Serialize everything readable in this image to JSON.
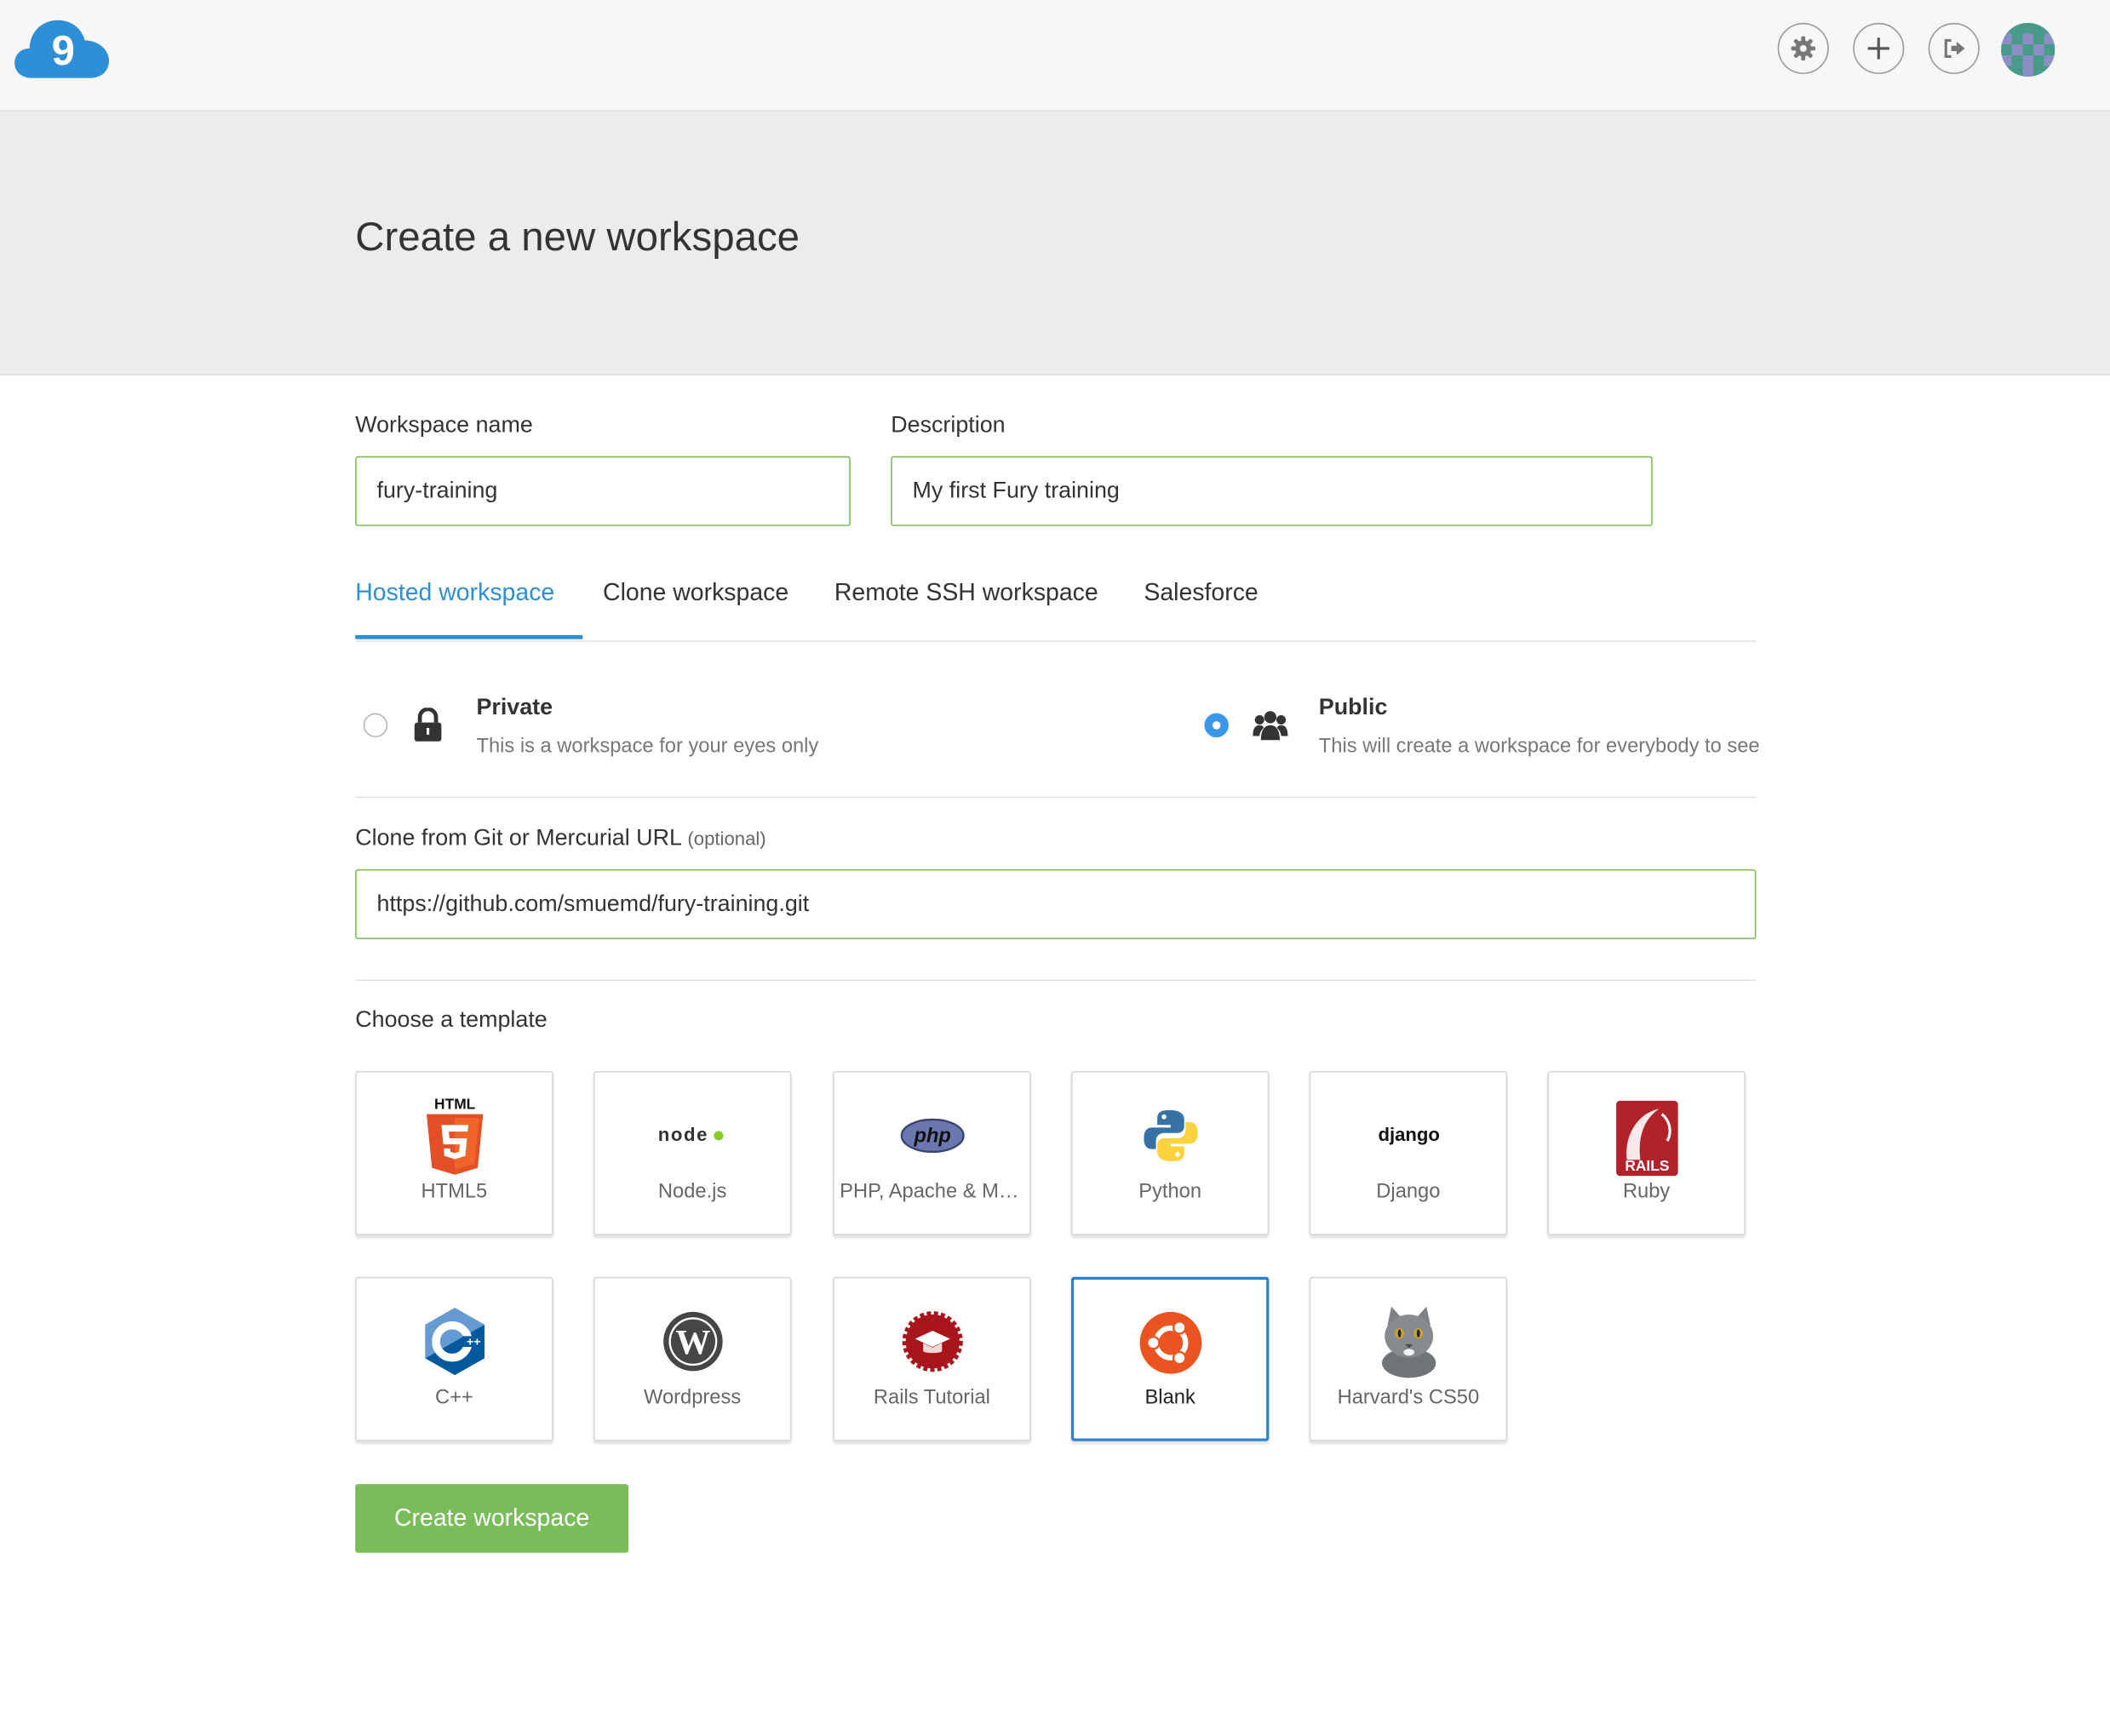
{
  "header": {
    "logo_icon": "cloud9-logo-icon",
    "logo_text": "9",
    "buttons": [
      {
        "icon": "gear-icon",
        "label": "Settings"
      },
      {
        "icon": "plus-icon",
        "label": "New"
      },
      {
        "icon": "sign-out-icon",
        "label": "Sign out"
      }
    ],
    "avatar_icon": "user-avatar"
  },
  "page": {
    "title": "Create a new workspace"
  },
  "form": {
    "workspace_name": {
      "label": "Workspace name",
      "value": "fury-training"
    },
    "description": {
      "label": "Description",
      "value": "My first Fury training"
    },
    "tabs": [
      {
        "label": "Hosted workspace",
        "active": true
      },
      {
        "label": "Clone workspace",
        "active": false
      },
      {
        "label": "Remote SSH workspace",
        "active": false
      },
      {
        "label": "Salesforce",
        "active": false
      }
    ],
    "visibility": {
      "private": {
        "title": "Private",
        "desc": "This is a workspace for your eyes only",
        "icon": "lock-icon",
        "selected": false
      },
      "public": {
        "title": "Public",
        "desc": "This will create a workspace for everybody to see",
        "icon": "users-icon",
        "selected": true
      }
    },
    "clone_url": {
      "label": "Clone from Git or Mercurial URL",
      "optional": "(optional)",
      "value": "https://github.com/smuemd/fury-training.git"
    },
    "template_heading": "Choose a template",
    "templates": [
      {
        "name": "HTML5",
        "icon": "html5-icon",
        "logo_text": "HTML"
      },
      {
        "name": "Node.js",
        "icon": "nodejs-icon",
        "logo_text": "node"
      },
      {
        "name": "PHP, Apache & MySQL",
        "icon": "php-icon",
        "logo_text": "php"
      },
      {
        "name": "Python",
        "icon": "python-icon"
      },
      {
        "name": "Django",
        "icon": "django-icon",
        "logo_text": "django"
      },
      {
        "name": "Ruby",
        "icon": "rails-icon",
        "logo_text": "RAILS"
      },
      {
        "name": "C++",
        "icon": "cpp-icon",
        "logo_text": "C++"
      },
      {
        "name": "Wordpress",
        "icon": "wordpress-icon",
        "logo_text": "W"
      },
      {
        "name": "Rails Tutorial",
        "icon": "rails-tutorial-icon"
      },
      {
        "name": "Blank",
        "icon": "ubuntu-icon",
        "selected": true
      },
      {
        "name": "Harvard's CS50",
        "icon": "cat-icon"
      }
    ],
    "submit_label": "Create workspace"
  },
  "colors": {
    "accent": "#2f8fd6",
    "field_border": "#7dbb55",
    "button": "#79bd5a"
  }
}
